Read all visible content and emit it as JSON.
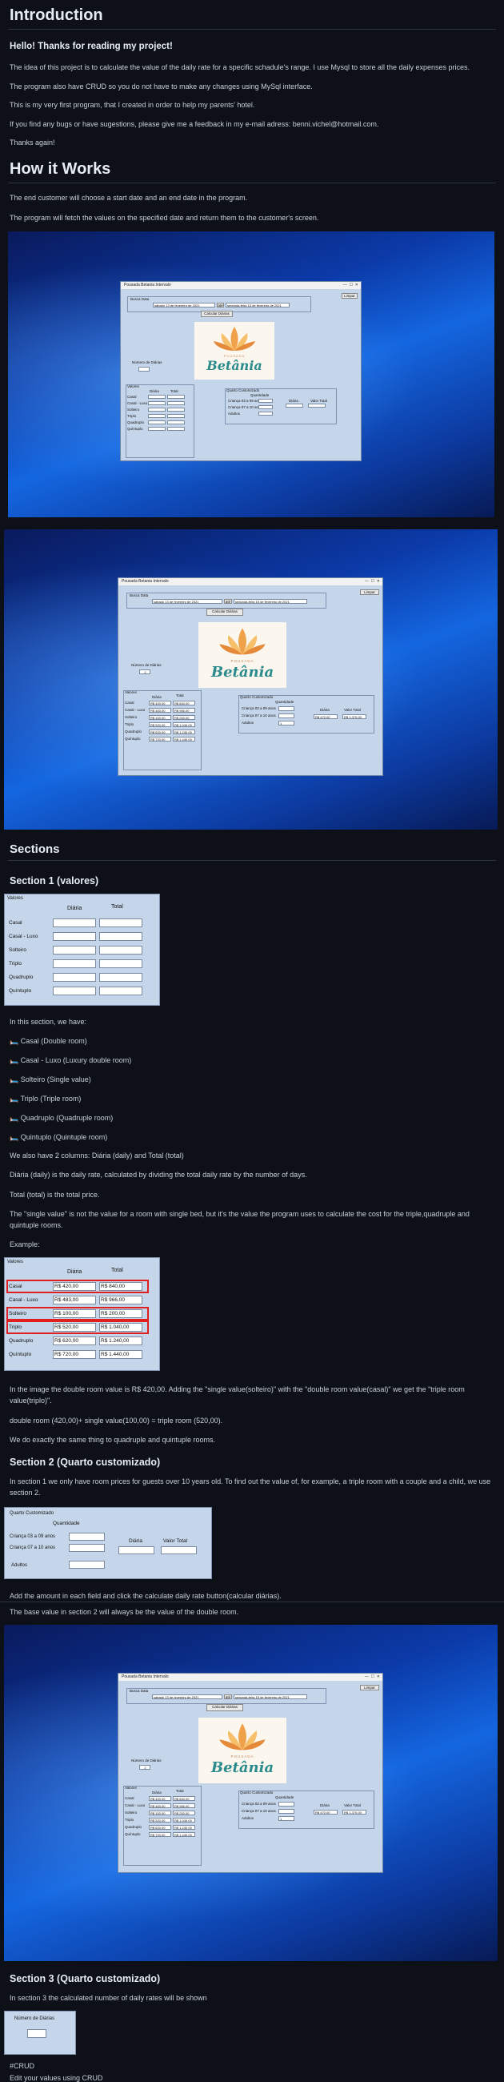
{
  "intro": {
    "title": "Introduction",
    "greeting": "Hello! Thanks for reading my project!",
    "p1": "The idea of this project is to calculate the value of the daily rate for a specific schadule's range. I use Mysql to store all the daily expenses prices.",
    "p2": "The program also have CRUD so you do not have to make any changes using MySql interface.",
    "p3": "This is my very first program, that I created in order to help my parents' hotel.",
    "p4": "If you find any bugs or have sugestions, please give me a feedback in my e-mail adress: benni.vichel@hotmail.com.",
    "p5": "Thanks again!"
  },
  "how": {
    "title": "How it Works",
    "p1": "The end customer will choose a start date and an end date in the program.",
    "p2": "The program will fetch the values on the specified date and return them to the customer's screen."
  },
  "app": {
    "window_title": "Pousada Betania Intervalo",
    "clear_button": "Limpar",
    "dates_label": "Busca Data",
    "start_date": "sábado     13 de fevereiro de 2021",
    "until": "até",
    "end_date": "segunda-feira     15 de fevereiro de 2021",
    "calc_button": "Calcular Diárias",
    "daily_count_label": "Número de Diárias",
    "daily_count_value": "2",
    "logo_sub": "POUSADA",
    "logo_name": "Betânia",
    "rooms_title": "Valores",
    "col_diaria": "Diária",
    "col_total": "Total",
    "rooms": [
      "Casal",
      "Casal - Luxo",
      "Solteiro",
      "Triplo",
      "Quadruplo",
      "Quíntuplo"
    ],
    "diaria_values": [
      "R$ 420,00",
      "R$ 483,00",
      "R$ 100,00",
      "R$ 520,00",
      "R$ 620,00",
      "R$ 720,00"
    ],
    "total_values": [
      "R$ 840,00",
      "R$ 966,00",
      "R$ 200,00",
      "R$ 1.040,00",
      "R$ 1.240,00",
      "R$ 1.440,00"
    ],
    "custom_title": "Quarto Customizado",
    "custom_qty": "Quantidade",
    "custom_child10": "Criança 03 a 09 anos",
    "custom_child_over": "Criança 07 a 10 anos",
    "custom_adults": "Adultos",
    "custom_diaria": "Diária",
    "custom_total": "Valor Total",
    "custom_qty_value": "1",
    "custom_diaria_value": "R$ 470,00",
    "custom_total_value": "R$ 1.370,00"
  },
  "sections": {
    "title": "Sections",
    "s1_title": "Section 1 (valores)",
    "s1_intro": "In this section, we have:",
    "s1_items": [
      "Casal (Double room)",
      "Casal - Luxo (Luxury double room)",
      "Solteiro (Single value)",
      "Triplo (Triple room)",
      "Quadruplo (Quadruple room)",
      "Quintuplo (Quintuple room)"
    ],
    "s1_bed_icon": "bed-emoji",
    "s1_cols": "We also have 2 columns: Diária (daily) and Total (total)",
    "s1_daily": "Diária (daily) is the daily rate, calculated by dividing the total daily rate by the number of days.",
    "s1_total": "Total (total) is the total price.",
    "s1_single": "The \"single value\" is not the value for a room with single bed, but it's the value the program uses to calculate the cost for the triple,quadruple and quintuple rooms.",
    "s1_example": "Example:",
    "s1_image_text": "In the image the double room value is R$ 420,00. Adding the \"single value(solteiro)\" with the \"double room value(casal)\" we get the \"triple room value(triplo)\".",
    "s1_formula": "double room (420,00)+ single value(100,00) = triple room (520,00).",
    "s1_same": "We do exactly the same thing to quadruple and quintuple rooms.",
    "s2_title": "Section 2 (Quarto customizado)",
    "s2_text": "In section 1 we only have room prices for guests over 10 years old. To find out the value of, for example, a triple room with a couple and a child, we use section 2.",
    "s2_add": "Add the amount in each field and click the calculate daily rate button(calcular diárias).",
    "s2_base": "The base value in section 2 will always be the value of the double room.",
    "s3_title": "Section 3 (Quarto customizado)",
    "s3_text": "In section 3 the calculated number of daily rates will be shown",
    "crud_title": "#CRUD",
    "crud_text": "Edit your values using CRUD"
  }
}
